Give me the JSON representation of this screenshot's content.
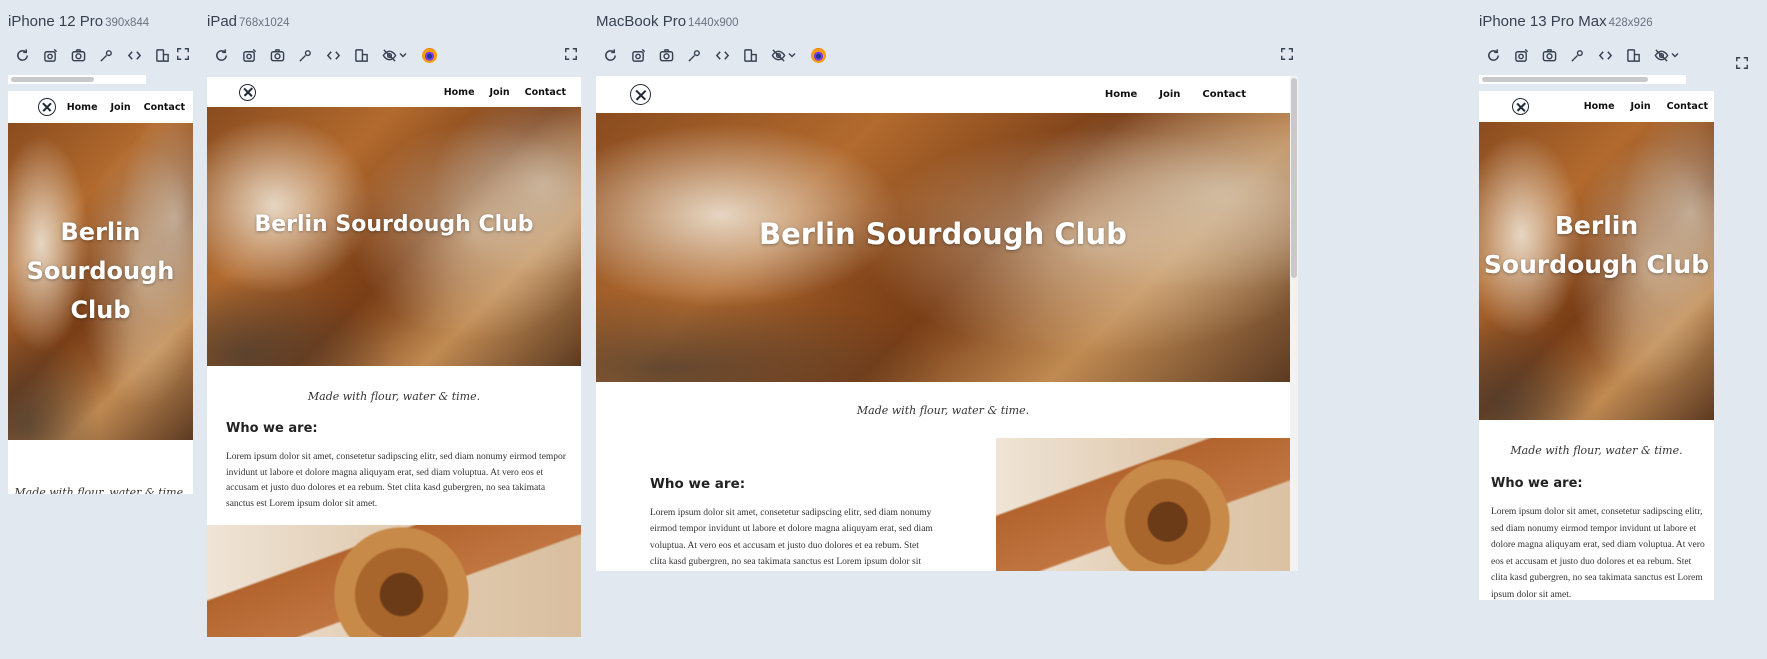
{
  "devices": [
    {
      "name": "iPhone 12 Pro",
      "size": "390x844"
    },
    {
      "name": "iPad",
      "size": "768x1024"
    },
    {
      "name": "MacBook Pro",
      "size": "1440x900"
    },
    {
      "name": "iPhone 13 Pro Max",
      "size": "428x926"
    }
  ],
  "toolbar_icons": [
    "refresh-icon",
    "rotate-camera-icon",
    "screenshot-icon",
    "inspect-icon",
    "code-icon",
    "device-layout-icon",
    "hide-icon",
    "firefox-icon",
    "expand-icon"
  ],
  "site": {
    "nav": {
      "home": "Home",
      "join": "Join",
      "contact": "Contact"
    },
    "hero_title": "Berlin Sourdough Club",
    "tagline": "Made with flour, water & time.",
    "who_heading": "Who we are:",
    "lorem": "Lorem ipsum dolor sit amet, consetetur sadipscing elitr, sed diam nonumy eirmod tempor invidunt ut labore et dolore magna aliquyam erat, sed diam voluptua. At vero eos et accusam et justo duo dolores et ea rebum. Stet clita kasd gubergren, no sea takimata sanctus est Lorem ipsum dolor sit amet."
  },
  "colors": {
    "page_bg": "#e2e8f0",
    "frame_bg": "#ffffff",
    "heading": "#222222"
  }
}
